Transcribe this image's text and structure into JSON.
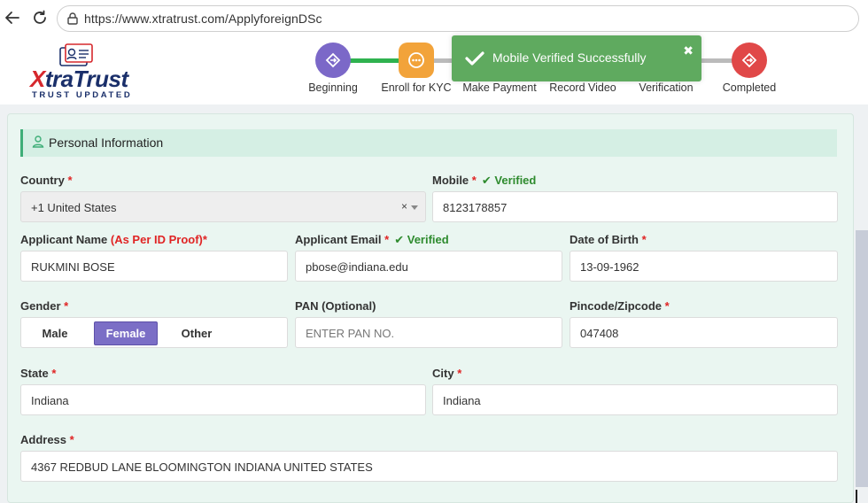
{
  "browser": {
    "url": "https://www.xtratrust.com/ApplyforeignDSc"
  },
  "logo": {
    "brand_x": "X",
    "brand_rest": "traTrust",
    "tagline": "TRUST UPDATED"
  },
  "steps": [
    {
      "label": "Beginning",
      "color": "#7b68c8",
      "icon": "diamond-arrow-icon"
    },
    {
      "label": "Enroll for KYC",
      "color": "#f2a33a",
      "icon": "more-dots-icon"
    },
    {
      "label": "Make Payment",
      "color": "#2e9a4e",
      "icon": "hourglass-icon"
    },
    {
      "label": "Record Video",
      "color": "#2e9a4e",
      "icon": "hourglass-icon"
    },
    {
      "label": "Verification",
      "color": "#2e9a4e",
      "icon": "hourglass-icon"
    },
    {
      "label": "Completed",
      "color": "#e04848",
      "icon": "diamond-arrow-icon"
    }
  ],
  "toast": {
    "message": "Mobile Verified Successfully",
    "close": "✖"
  },
  "section": {
    "title": "Personal Information"
  },
  "form": {
    "country_label": "Country",
    "country_value": "+1 United States",
    "country_clear": "×",
    "mobile_label": "Mobile",
    "mobile_value": "8123178857",
    "verified": "Verified",
    "applicant_name_label": "Applicant Name",
    "applicant_name_hint": "(As Per ID Proof)",
    "applicant_name_value": "RUKMINI BOSE",
    "applicant_email_label": "Applicant Email",
    "applicant_email_value": "pbose@indiana.edu",
    "dob_label": "Date of Birth",
    "dob_value": "13-09-1962",
    "gender_label": "Gender",
    "gender_options": [
      "Male",
      "Female",
      "Other"
    ],
    "gender_selected": "Female",
    "pan_label": "PAN (Optional)",
    "pan_placeholder": "ENTER PAN NO.",
    "pincode_label": "Pincode/Zipcode",
    "pincode_value": "047408",
    "state_label": "State",
    "state_value": "Indiana",
    "city_label": "City",
    "city_value": "Indiana",
    "address_label": "Address",
    "address_value": "4367 REDBUD LANE BLOOMINGTON INDIANA UNITED STATES",
    "required_mark": "*"
  },
  "colors": {
    "accent_green": "#3fae78",
    "verified_green": "#2e8b2e",
    "required_red": "#e02424",
    "gender_active": "#7b6ec6",
    "toast_bg": "#51a351"
  }
}
